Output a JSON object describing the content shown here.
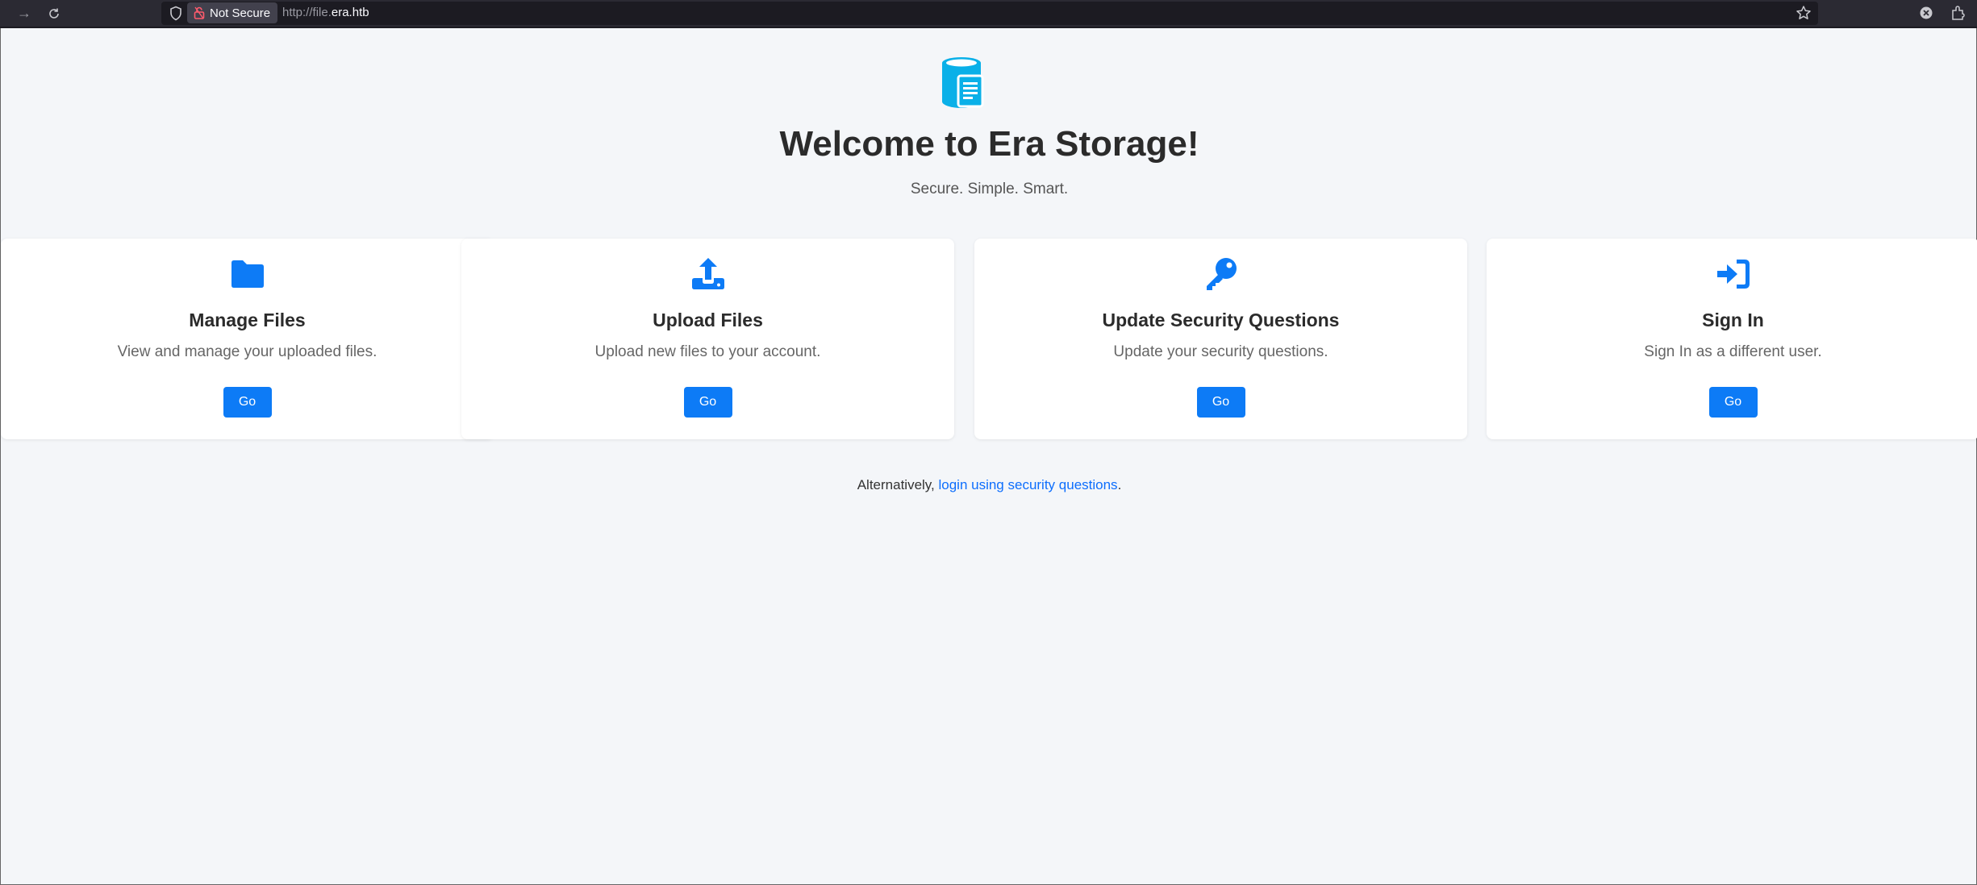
{
  "browser": {
    "not_secure_label": "Not Secure",
    "url_prefix": "http://file.",
    "url_host": "era.htb"
  },
  "page": {
    "title": "Welcome to Era Storage!",
    "subtitle": "Secure. Simple. Smart.",
    "accent_color": "#0d7bf6",
    "cards": [
      {
        "icon": "folder-icon",
        "title": "Manage Files",
        "description": "View and manage your uploaded files.",
        "button": "Go"
      },
      {
        "icon": "upload-icon",
        "title": "Upload Files",
        "description": "Upload new files to your account.",
        "button": "Go"
      },
      {
        "icon": "key-icon",
        "title": "Update Security Questions",
        "description": "Update your security questions.",
        "button": "Go"
      },
      {
        "icon": "sign-in-icon",
        "title": "Sign In",
        "description": "Sign In as a different user.",
        "button": "Go"
      }
    ],
    "alt_prefix": "Alternatively, ",
    "alt_link": "login using security questions",
    "alt_suffix": "."
  }
}
